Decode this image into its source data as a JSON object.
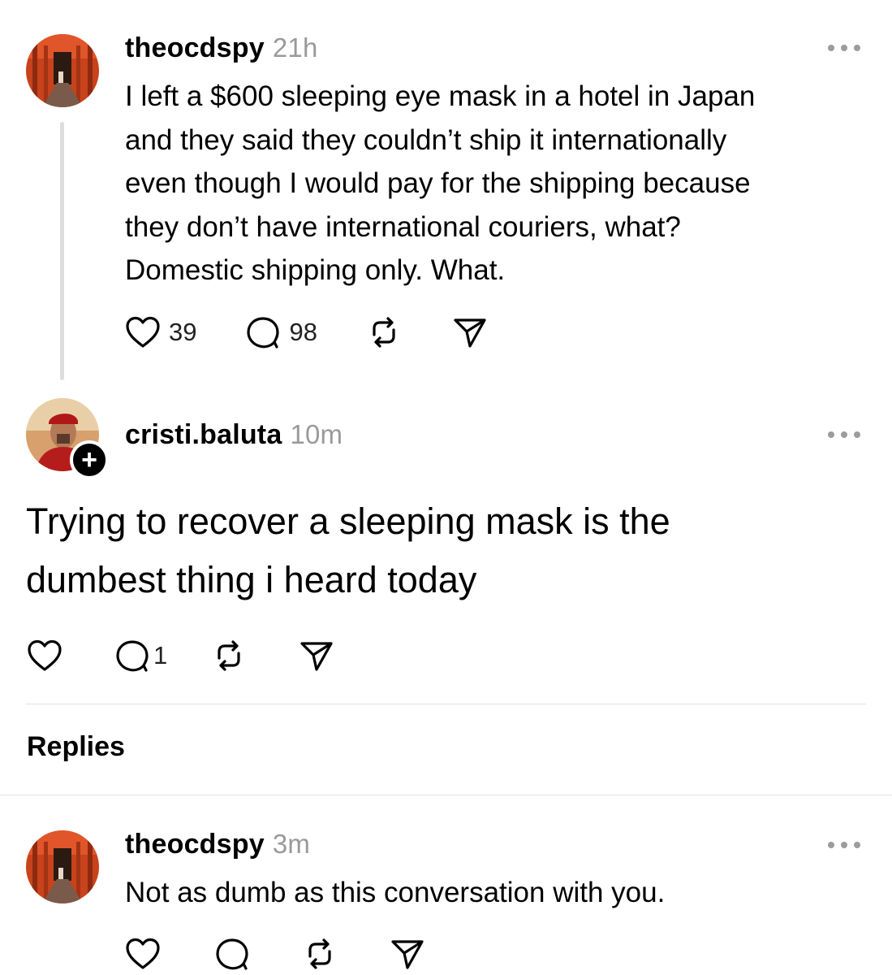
{
  "post": {
    "username": "theocdspy",
    "time": "21h",
    "lines": [
      "I left a $600 sleeping eye mask in a hotel in Japan",
      "and they said they couldn’t ship it internationally",
      "even though I would pay for the shipping because",
      "they don’t have international couriers, what?",
      "Domestic shipping only. What."
    ],
    "likes": "39",
    "comments": "98"
  },
  "comment": {
    "username": "cristi.baluta",
    "time": "10m",
    "lines": [
      "Trying to recover a sleeping mask is the",
      "dumbest thing i heard today"
    ],
    "comments": "1"
  },
  "replies_header": "Replies",
  "reply": {
    "username": "theocdspy",
    "time": "3m",
    "text": "Not as dumb as this conversation with you."
  }
}
